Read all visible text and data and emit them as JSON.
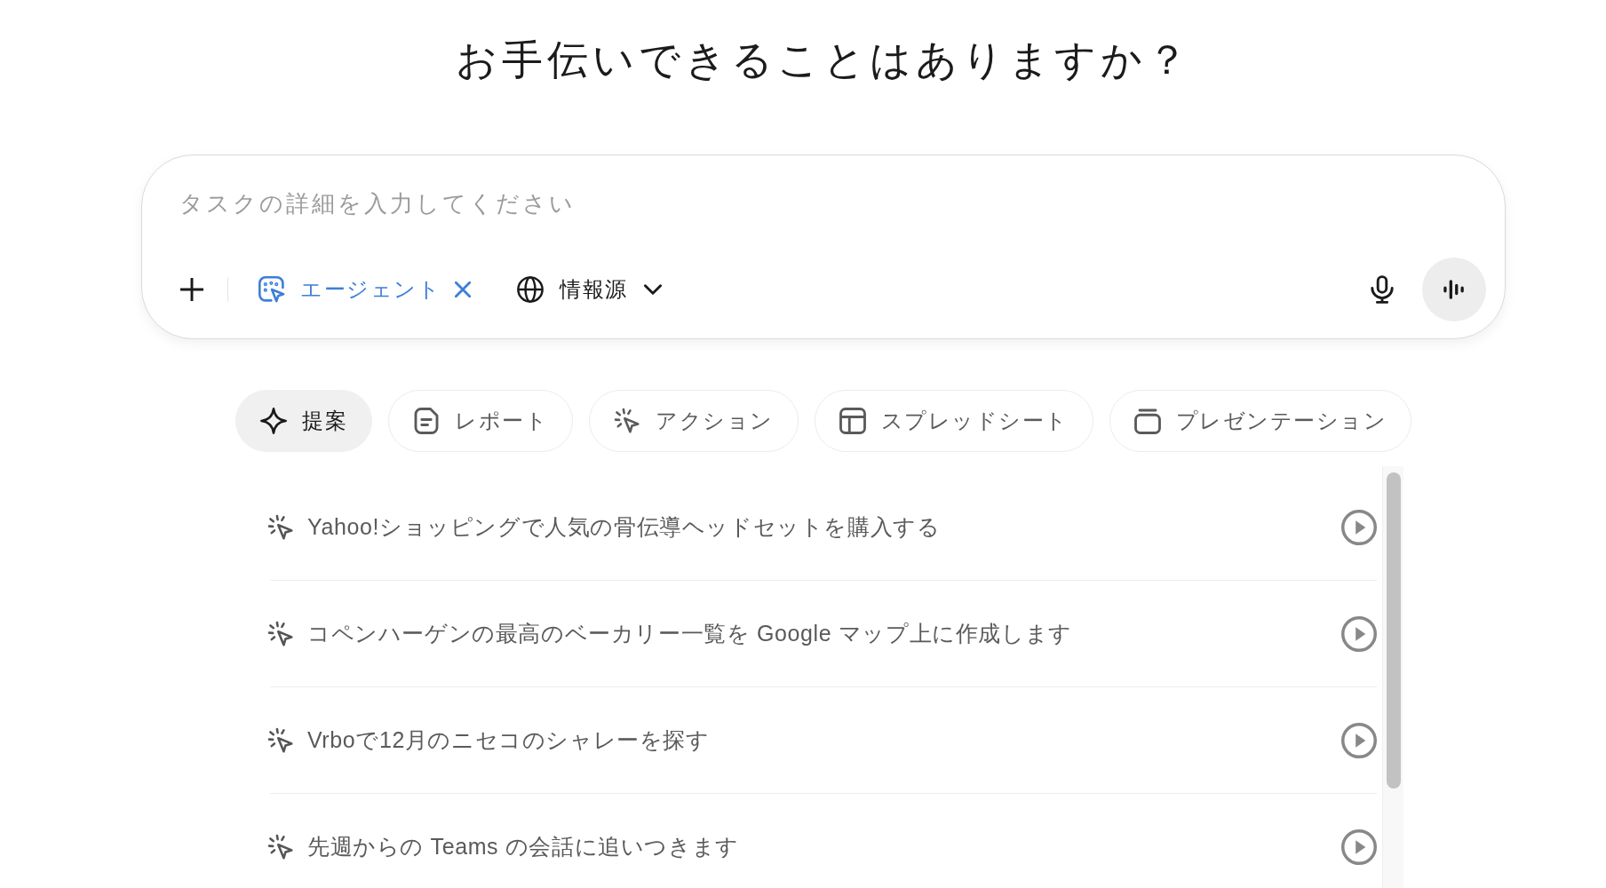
{
  "heading": "お手伝いできることはありますか？",
  "composer": {
    "placeholder": "タスクの詳細を入力してください",
    "mode": {
      "label": "エージェント"
    },
    "source": {
      "label": "情報源"
    }
  },
  "tabs": [
    {
      "label": "提案",
      "kind": "suggest",
      "selected": true
    },
    {
      "label": "レポート",
      "kind": "report",
      "selected": false
    },
    {
      "label": "アクション",
      "kind": "action",
      "selected": false
    },
    {
      "label": "スプレッドシート",
      "kind": "sheet",
      "selected": false
    },
    {
      "label": "プレゼンテーション",
      "kind": "slides",
      "selected": false
    }
  ],
  "suggestions": [
    {
      "text": "Yahoo!ショッピングで人気の骨伝導ヘッドセットを購入する"
    },
    {
      "text": "コペンハーゲンの最高のベーカリー一覧を Google マップ上に作成します"
    },
    {
      "text": "Vrboで12月のニセコのシャレーを探す"
    },
    {
      "text": "先週からの Teams の会話に追いつきます"
    }
  ]
}
